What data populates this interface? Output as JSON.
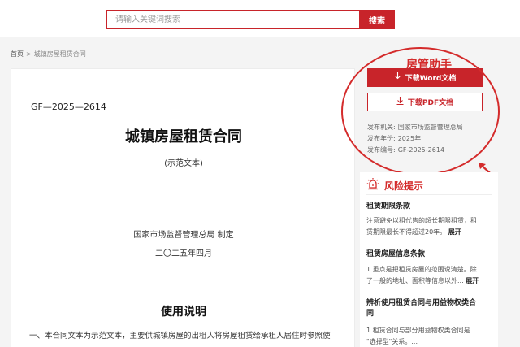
{
  "search": {
    "placeholder": "请输入关键词搜索",
    "button_label": "搜索"
  },
  "breadcrumb": {
    "home": "首页",
    "separator": ">",
    "current": "城镇房屋租赁合同"
  },
  "document": {
    "code": "GF—2025—2614",
    "title": "城镇房屋租赁合同",
    "subtitle": "(示范文本)",
    "org": "国家市场监督管理总局 制定",
    "date": "二〇二五年四月",
    "section_title": "使用说明",
    "first_paragraph": "一、本合同文本为示范文本，主要供城镇房屋的出租人将房屋租赁给承租人居住时参照使"
  },
  "helper": {
    "title": "房管助手",
    "download_word": "下载Word文档",
    "download_pdf": "下载PDF文档",
    "meta": [
      {
        "label": "发布机关:",
        "value": "国家市场监督管理总局"
      },
      {
        "label": "发布年份:",
        "value": "2025年"
      },
      {
        "label": "发布编号:",
        "value": "GF-2025-2614"
      }
    ]
  },
  "risk": {
    "heading": "风险提示",
    "more_label": "展开",
    "items": [
      {
        "title": "租赁期限条款",
        "body_line1": "注意避免以租代售的超长期限租赁，租",
        "body_line2": "赁期限最长不得超过20年。"
      },
      {
        "title": "租赁房屋信息条款",
        "body_line1": "1.重点是把租赁房屋的范围说清楚。除",
        "body_line2": "了一般的地址、面积等信息以外..."
      },
      {
        "title_line1": "辨析使用租赁合同与用益物权类合",
        "title_line2": "同",
        "body_line1": "1.租赁合同与部分用益物权类合同是",
        "body_line2": "\"选择型\"关系。..."
      }
    ]
  },
  "colors": {
    "accent": "#c8242a",
    "highlight": "#d42b2b"
  }
}
